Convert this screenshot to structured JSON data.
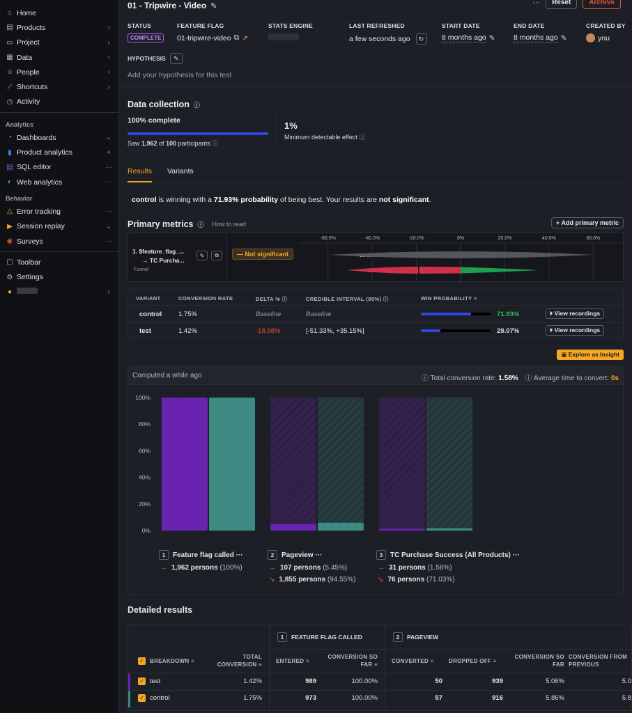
{
  "sidebar": {
    "items": [
      {
        "label": "Home",
        "icon": "home-icon",
        "trail": ""
      },
      {
        "label": "Products",
        "icon": "products-icon",
        "trail": "›"
      },
      {
        "label": "Project",
        "icon": "folder-icon",
        "trail": "›"
      },
      {
        "label": "Data",
        "icon": "database-icon",
        "trail": "›"
      },
      {
        "label": "People",
        "icon": "people-icon",
        "trail": "›"
      },
      {
        "label": "Shortcuts",
        "icon": "shortcut-icon",
        "trail": "›"
      },
      {
        "label": "Activity",
        "icon": "clock-icon",
        "trail": ""
      }
    ],
    "analytics_header": "Analytics",
    "analytics": [
      {
        "label": "Dashboards",
        "icon": "dashboard-icon",
        "trail": "⌄"
      },
      {
        "label": "Product analytics",
        "icon": "bar-chart-icon",
        "trail": "+"
      },
      {
        "label": "SQL editor",
        "icon": "sql-icon",
        "trail": "···"
      },
      {
        "label": "Web analytics",
        "icon": "web-icon",
        "trail": "···"
      }
    ],
    "behavior_header": "Behavior",
    "behavior": [
      {
        "label": "Error tracking",
        "icon": "warning-icon",
        "trail": "···"
      },
      {
        "label": "Session replay",
        "icon": "replay-icon",
        "trail": "⌄"
      },
      {
        "label": "Surveys",
        "icon": "survey-icon",
        "trail": "···"
      }
    ],
    "bottom": [
      {
        "label": "Toolbar",
        "icon": "toolbar-icon",
        "trail": ""
      },
      {
        "label": "Settings",
        "icon": "gear-icon",
        "trail": ""
      }
    ]
  },
  "header": {
    "title": "01 - Tripwire - Video",
    "reset": "Reset",
    "archive": "Archive",
    "more": "···"
  },
  "meta": {
    "status_h": "STATUS",
    "status_v": "COMPLETE",
    "flag_h": "FEATURE FLAG",
    "flag_v": "01-tripwire-video",
    "engine_h": "STATS ENGINE",
    "refreshed_h": "LAST REFRESHED",
    "refreshed_v": "a few seconds ago",
    "start_h": "START DATE",
    "start_v": "8 months ago",
    "end_h": "END DATE",
    "end_v": "8 months ago",
    "created_h": "CREATED BY",
    "created_v": "you"
  },
  "hypothesis": {
    "h": "HYPOTHESIS",
    "placeholder": "Add your hypothesis for this test"
  },
  "data_collection": {
    "title": "Data collection",
    "complete": "100% complete",
    "progress": 1.0,
    "saw_pre": "Saw ",
    "saw_n": "1,962",
    "saw_mid": " of ",
    "saw_total": "100",
    "saw_post": " participants",
    "mde_value": "1%",
    "mde_label": "Minimum detectable effect"
  },
  "tabs": [
    "Results",
    "Variants"
  ],
  "summary": {
    "variant": "control",
    "t1": " is winning with a ",
    "prob": "71.93% probability",
    "t2": " of being best. Your results are ",
    "sig": "not significant",
    "t3": "."
  },
  "primary_metrics": {
    "title": "Primary metrics",
    "how": "How to read",
    "add": "Add primary metric",
    "metric_line1": "1. $feature_flag_...",
    "metric_line2": "→ TC Purcha...",
    "metric_type": "Funnel",
    "status": "Not significant",
    "axis": [
      "-60.0%",
      "-40.0%",
      "-20.0%",
      "0%",
      "20.0%",
      "40.0%",
      "60.0%"
    ],
    "rows": [
      {
        "name": "control",
        "low": -60.0,
        "high": 60.0,
        "delta": 0
      },
      {
        "name": "test",
        "low": -51.33,
        "high": 35.15,
        "delta": -18.98
      }
    ]
  },
  "variants_table": {
    "headers": [
      "VARIANT",
      "CONVERSION RATE",
      "DELTA %",
      "CREDIBLE INTERVAL (95%)",
      "WIN PROBABILITY"
    ],
    "rows": [
      {
        "variant": "control",
        "rate": "1.75%",
        "delta": "Baseline",
        "interval": "Baseline",
        "win": 0.7193,
        "win_label": "71.93%",
        "action": "View recordings"
      },
      {
        "variant": "test",
        "rate": "1.42%",
        "delta": "-18.98%",
        "interval": "[-51.33%, +35.15%]",
        "win": 0.2807,
        "win_label": "28.07%",
        "action": "View recordings"
      }
    ]
  },
  "explore": "Explore as Insight",
  "funnel": {
    "computed": "Computed a while ago",
    "total_label": "Total conversion rate:",
    "total_value": "1.58%",
    "avg_label": "Average time to convert:",
    "avg_value": "0s",
    "chart_data": {
      "type": "bar",
      "categories": [
        "Feature flag called",
        "Pageview",
        "TC Purchase Success (All Products)"
      ],
      "ylim": [
        0,
        100
      ],
      "ticks": [
        "100%",
        "80%",
        "60%",
        "40%",
        "20%",
        "0%"
      ],
      "series": [
        {
          "name": "test",
          "color": "#6a22b0",
          "values": [
            100,
            5.06,
            1.42
          ]
        },
        {
          "name": "control",
          "color": "#3c8a82",
          "values": [
            100,
            5.86,
            1.75
          ]
        }
      ]
    },
    "steps": [
      {
        "num": "1",
        "name": "Feature flag called",
        "conv": "1,962 persons",
        "conv_pct": "(100%)",
        "drop": "",
        "drop_pct": ""
      },
      {
        "num": "2",
        "name": "Pageview",
        "conv": "107 persons",
        "conv_pct": "(5.45%)",
        "drop": "1,855 persons",
        "drop_pct": "(94.55%)"
      },
      {
        "num": "3",
        "name": "TC Purchase Success (All Products)",
        "conv": "31 persons",
        "conv_pct": "(1.58%)",
        "drop": "76 persons",
        "drop_pct": "(71.03%)"
      }
    ]
  },
  "detailed": {
    "title": "Detailed results",
    "group1_num": "1",
    "group1": "FEATURE FLAG CALLED",
    "group2_num": "2",
    "group2": "PAGEVIEW",
    "headers": [
      "BREAKDOWN",
      "TOTAL CONVERSION",
      "ENTERED",
      "CONVERSION SO FAR",
      "CONVERTED",
      "DROPPED OFF",
      "CONVERSION SO FAR",
      "CONVERSION FROM PREVIOUS"
    ],
    "rows": [
      {
        "breakdown": "test",
        "color": "#6a22b0",
        "total": "1.42%",
        "entered": "989",
        "so_far1": "100.00%",
        "converted": "50",
        "dropped": "939",
        "so_far2": "5.06%",
        "prev": "5.0"
      },
      {
        "breakdown": "control",
        "color": "#3c8a82",
        "total": "1.75%",
        "entered": "973",
        "so_far1": "100.00%",
        "converted": "57",
        "dropped": "916",
        "so_far2": "5.86%",
        "prev": "5.8"
      }
    ]
  }
}
